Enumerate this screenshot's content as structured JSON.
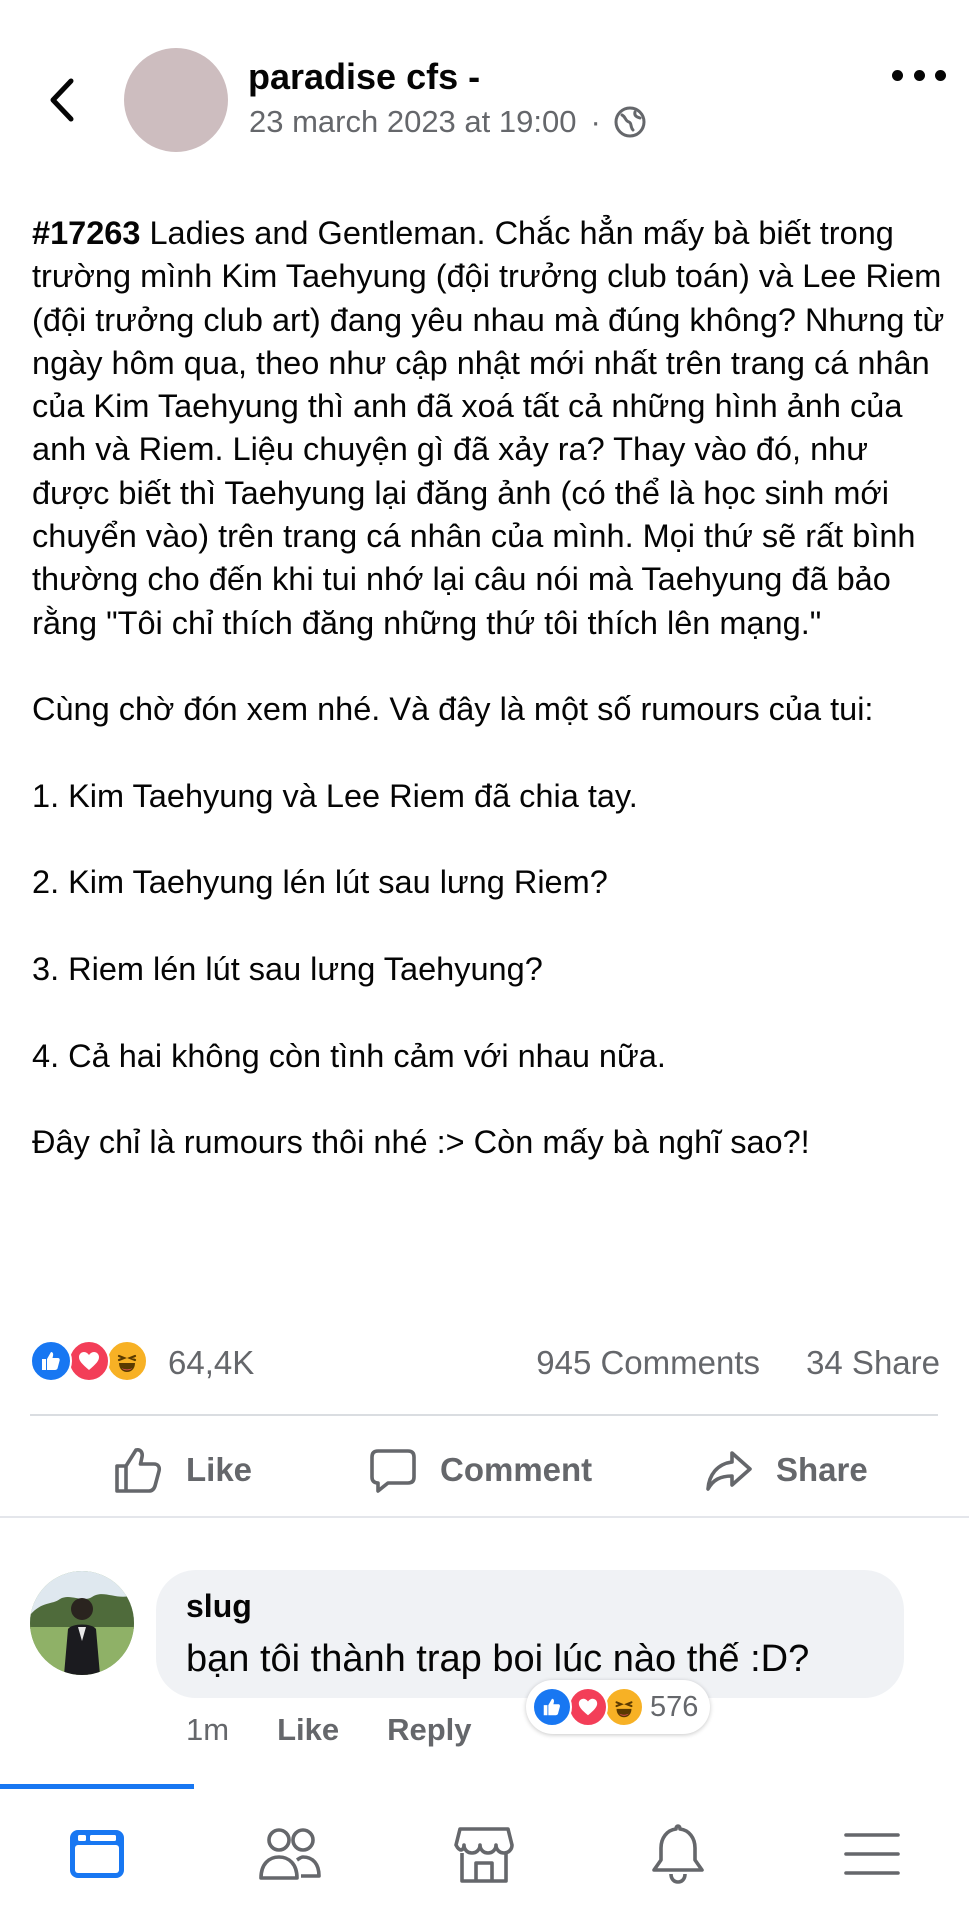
{
  "header": {
    "page_name": "paradise cfs -",
    "timestamp": "23 march 2023 at 19:00",
    "separator": "·",
    "privacy_icon": "globe-icon",
    "back_icon": "chevron-left-icon",
    "more_icon": "more-horizontal-icon"
  },
  "post": {
    "tag": "#17263",
    "paragraphs": [
      " Ladies and Gentleman. Chắc hẳn mấy bà biết trong trường mình Kim Taehyung (đội trưởng club toán) và Lee Riem (đội trưởng club art) đang yêu nhau mà đúng không? Nhưng từ ngày hôm qua, theo như cập nhật mới nhất trên trang cá nhân của Kim Taehyung thì anh đã xoá tất cả những hình ảnh của anh và Riem. Liệu chuyện gì đã xảy ra? Thay vào đó, như được biết thì Taehyung lại đăng ảnh (có thể là học sinh mới chuyển vào) trên trang cá nhân của mình. Mọi thứ sẽ rất bình thường cho đến khi tui nhớ lại câu nói mà Taehyung đã bảo rằng \"Tôi chỉ thích đăng những thứ tôi thích lên mạng.\"",
      "Cùng chờ đón xem nhé. Và đây là một số rumours của tui:",
      "1. Kim Taehyung và Lee Riem đã chia tay.",
      "2. Kim Taehyung lén lút sau lưng Riem?",
      "3. Riem lén lút sau lưng Taehyung?",
      "4. Cả hai không còn tình cảm với nhau nữa.",
      "Đây chỉ là rumours thôi nhé :> Còn mấy bà nghĩ sao?!"
    ]
  },
  "stats": {
    "reactions_count": "64,4K",
    "comments": "945 Comments",
    "shares": "34 Share"
  },
  "actions": {
    "like": "Like",
    "comment": "Comment",
    "share": "Share"
  },
  "comment": {
    "author": "slug",
    "text": "bạn tôi thành trap boi lúc nào thế :D?",
    "reactions_count": "576",
    "time": "1m",
    "like_label": "Like",
    "reply_label": "Reply"
  },
  "colors": {
    "brand_blue": "#1877f2",
    "love_red": "#f33e58",
    "haha_yellow": "#f7b125",
    "secondary_text": "#65676b",
    "bubble_bg": "#f0f2f5"
  },
  "bottom_nav": {
    "items": [
      "feed-icon",
      "friends-icon",
      "marketplace-icon",
      "notifications-icon",
      "menu-icon"
    ],
    "active_index": 0
  }
}
